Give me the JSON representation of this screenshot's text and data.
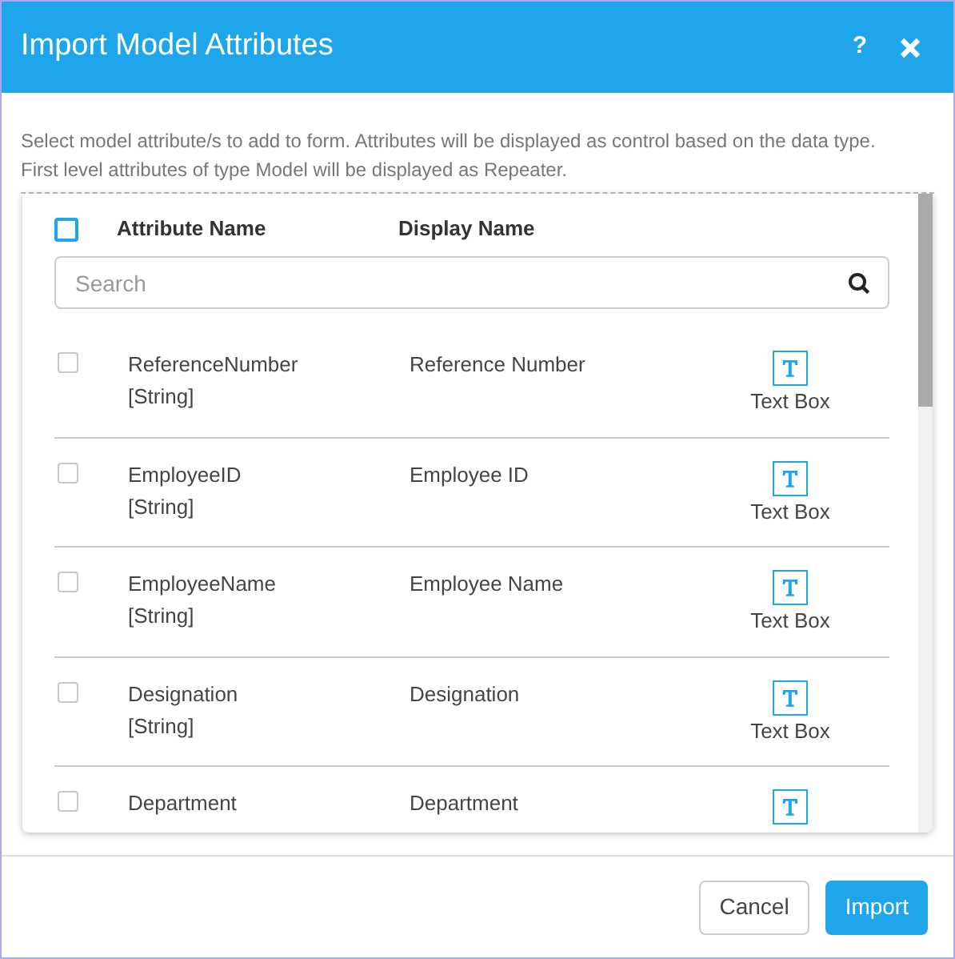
{
  "window": {
    "title": "Import Model Attributes",
    "help": "?"
  },
  "description": "Select model attribute/s to add to form. Attributes will be displayed as control based on the data type. First level attributes of type Model will be displayed as Repeater.",
  "table": {
    "select_all": {
      "checked": false
    },
    "columns": [
      "Attribute Name",
      "Display Name"
    ],
    "search": {
      "placeholder": "Search"
    },
    "rows": [
      {
        "name": "ReferenceNumber",
        "type": "[String]",
        "display": "Reference Number",
        "control": "Text Box",
        "checked": false
      },
      {
        "name": "EmployeeID",
        "type": "[String]",
        "display": "Employee ID",
        "control": "Text Box",
        "checked": false
      },
      {
        "name": "EmployeeName",
        "type": "[String]",
        "display": "Employee Name",
        "control": "Text Box",
        "checked": false
      },
      {
        "name": "Designation",
        "type": "[String]",
        "display": "Designation",
        "control": "Text Box",
        "checked": false
      },
      {
        "name": "Department",
        "display": "Department",
        "checked": false
      }
    ]
  },
  "buttons": [
    {
      "label": "Cancel",
      "kind": "secondary"
    },
    {
      "label": "Import",
      "kind": "primary"
    }
  ]
}
